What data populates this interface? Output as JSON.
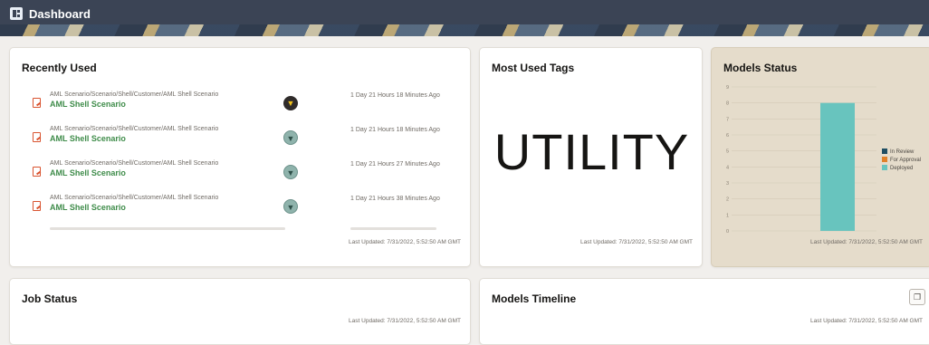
{
  "app": {
    "title": "Dashboard",
    "icon": "dashboard-grid-icon"
  },
  "recently_used": {
    "title": "Recently Used",
    "items": [
      {
        "path": "AML Scenario/Scenario/Shell/Customer/AML Shell Scenario",
        "name": "AML Shell Scenario",
        "time": "1 Day 21 Hours 18 Minutes Ago",
        "trophy": "dark"
      },
      {
        "path": "AML Scenario/Scenario/Shell/Customer/AML Shell Scenario",
        "name": "AML Shell Scenario",
        "time": "1 Day 21 Hours 18 Minutes Ago",
        "trophy": "light"
      },
      {
        "path": "AML Scenario/Scenario/Shell/Customer/AML Shell Scenario",
        "name": "AML Shell Scenario",
        "time": "1 Day 21 Hours 27 Minutes Ago",
        "trophy": "light"
      },
      {
        "path": "AML Scenario/Scenario/Shell/Customer/AML Shell Scenario",
        "name": "AML Shell Scenario",
        "time": "1 Day 21 Hours 38 Minutes Ago",
        "trophy": "light"
      }
    ],
    "last_updated": "Last Updated: 7/31/2022, 5:52:50 AM GMT"
  },
  "most_used_tags": {
    "title": "Most Used Tags",
    "tag": "UTILITY",
    "last_updated": "Last Updated: 7/31/2022, 5:52:50 AM GMT"
  },
  "models_status": {
    "title": "Models Status",
    "last_updated": "Last Updated: 7/31/2022, 5:52:50 AM GMT",
    "chart_data": {
      "type": "bar",
      "categories": [
        ""
      ],
      "series": [
        {
          "name": "In Review",
          "color": "#1f4e63",
          "values": [
            0
          ]
        },
        {
          "name": "For Approval",
          "color": "#e0812a",
          "values": [
            0
          ]
        },
        {
          "name": "Deployed",
          "color": "#68c4be",
          "values": [
            8
          ]
        }
      ],
      "ylim": [
        0,
        9
      ],
      "yticks": [
        "0",
        "1",
        "2",
        "3",
        "4",
        "5",
        "6",
        "7",
        "8",
        "9"
      ],
      "legend": "right",
      "grid": true
    }
  },
  "job_status": {
    "title": "Job Status",
    "last_updated": "Last Updated: 7/31/2022, 5:52:50 AM GMT"
  },
  "models_timeline": {
    "title": "Models Timeline",
    "button_icon": "copy-icon",
    "last_updated": "Last Updated: 7/31/2022, 5:52:50 AM GMT"
  }
}
